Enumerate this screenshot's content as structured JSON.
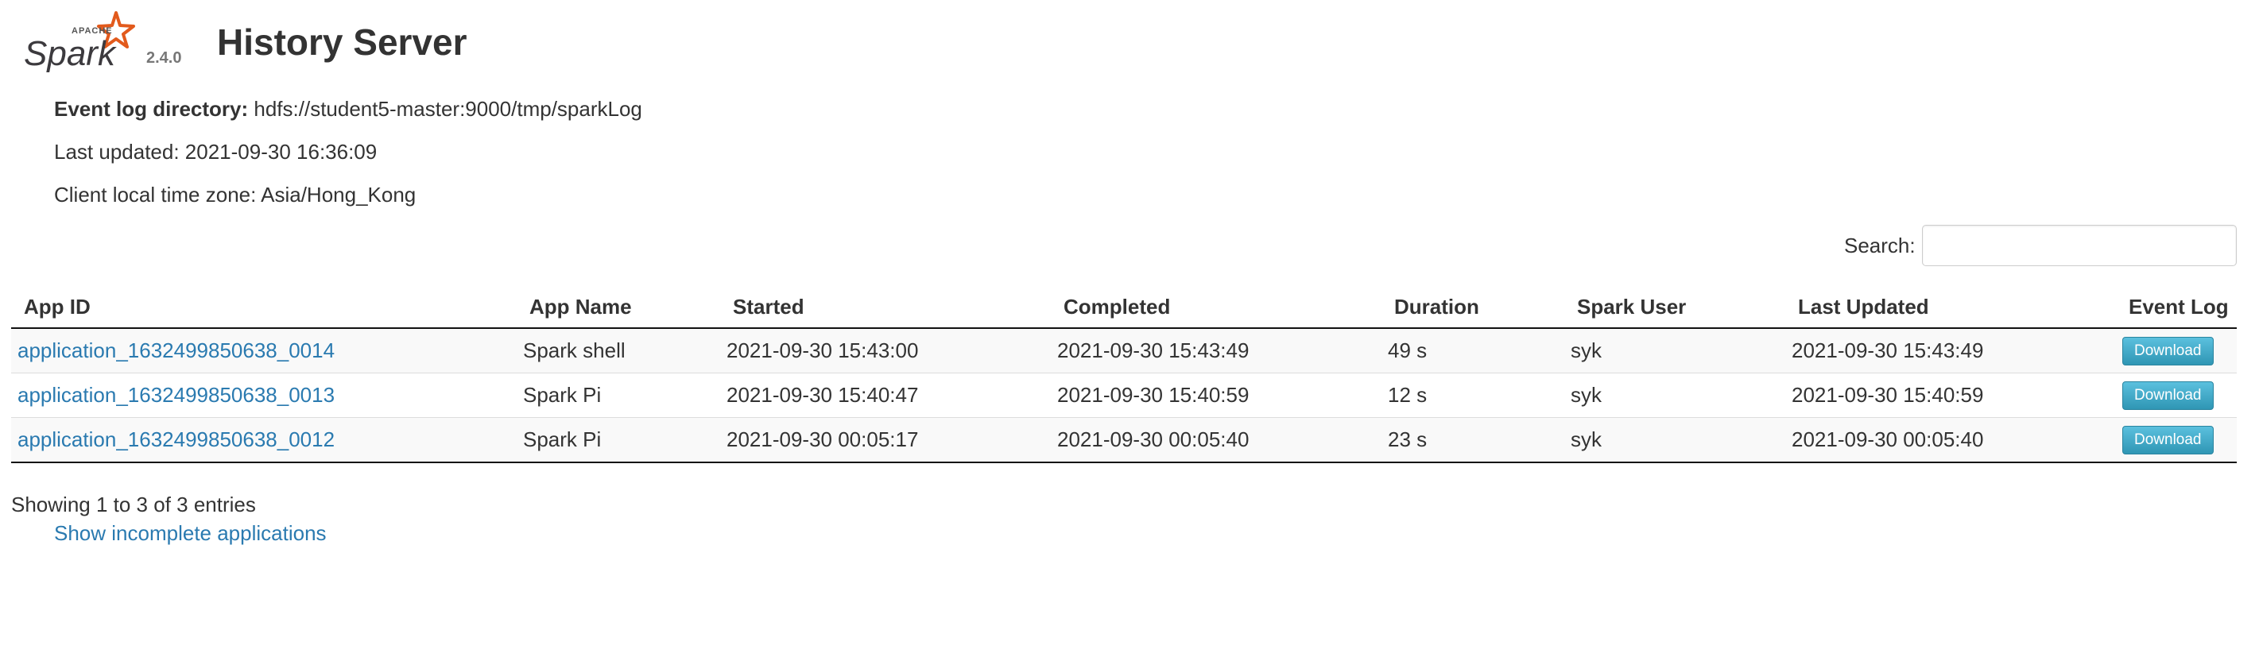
{
  "header": {
    "logo_text": "Spark",
    "logo_apache": "APACHE",
    "version": "2.4.0",
    "title": "History Server"
  },
  "info": {
    "event_log_label": "Event log directory:",
    "event_log_value": "hdfs://student5-master:9000/tmp/sparkLog",
    "last_updated": "Last updated: 2021-09-30 16:36:09",
    "timezone": "Client local time zone: Asia/Hong_Kong"
  },
  "search": {
    "label": "Search:",
    "value": ""
  },
  "table": {
    "columns": [
      "App ID",
      "App Name",
      "Started",
      "Completed",
      "Duration",
      "Spark User",
      "Last Updated",
      "Event Log"
    ],
    "rows": [
      {
        "app_id": "application_1632499850638_0014",
        "app_name": "Spark shell",
        "started": "2021-09-30 15:43:00",
        "completed": "2021-09-30 15:43:49",
        "duration": "49 s",
        "user": "syk",
        "last_updated": "2021-09-30 15:43:49",
        "event_log": "Download"
      },
      {
        "app_id": "application_1632499850638_0013",
        "app_name": "Spark Pi",
        "started": "2021-09-30 15:40:47",
        "completed": "2021-09-30 15:40:59",
        "duration": "12 s",
        "user": "syk",
        "last_updated": "2021-09-30 15:40:59",
        "event_log": "Download"
      },
      {
        "app_id": "application_1632499850638_0012",
        "app_name": "Spark Pi",
        "started": "2021-09-30 00:05:17",
        "completed": "2021-09-30 00:05:40",
        "duration": "23 s",
        "user": "syk",
        "last_updated": "2021-09-30 00:05:40",
        "event_log": "Download"
      }
    ]
  },
  "footer": {
    "showing": "Showing 1 to 3 of 3 entries",
    "incomplete_link": "Show incomplete applications"
  },
  "colors": {
    "link": "#2a7ab0",
    "spark_orange": "#e25a1c",
    "button": "#49afcd"
  }
}
